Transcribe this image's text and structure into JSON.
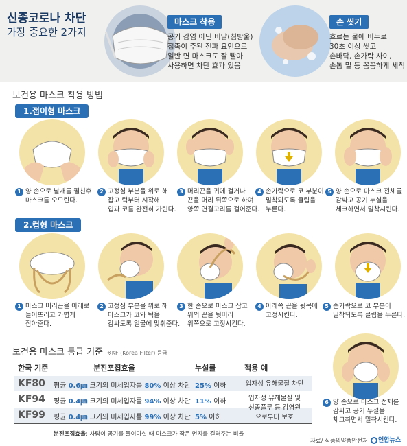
{
  "header": {
    "title_line1": "신종코로나 차단",
    "title_line2": "가장 중요한 2가지"
  },
  "mask_wearing": {
    "badge": "마스크 착용",
    "lines": [
      "공기 감염 아닌 비말(침방울)",
      "접촉이 주된 전파 요인으로",
      "일반 면 마스크도 잘 빨아",
      "사용하면 차단 효과 있음"
    ]
  },
  "hand_washing": {
    "badge": "손 씻기",
    "lines": [
      "흐르는 물에 비누로",
      "30초 이상 씻고",
      "손바닥, 손가락 사이,",
      "손톱 밑 등 꼼꼼하게 세척"
    ]
  },
  "method_title": "보건용 마스크 착용 방법",
  "foldable": {
    "label": "1.접이형 마스크",
    "steps": [
      {
        "num": "1",
        "lines": [
          "양 손으로 날개를 펼친후",
          "마스크를 오므린다."
        ]
      },
      {
        "num": "2",
        "lines": [
          "고정심 부분을 위로 해",
          "잡고 턱부터 시작해",
          "입과 코를 완전히 가린다."
        ]
      },
      {
        "num": "3",
        "lines": [
          "머리끈을 귀에 걸거나",
          "끈을 머리 뒤쪽으로 하여",
          "양쪽 연결고리를 걸어준다."
        ]
      },
      {
        "num": "4",
        "lines": [
          "손가락으로 코 부분이",
          "밀착되도록 클립을",
          "누른다."
        ]
      },
      {
        "num": "5",
        "lines": [
          "양 손으로 마스크 전체를",
          "감싸고 공기 누설을",
          "체크하면서 밀착시킨다."
        ]
      }
    ]
  },
  "cup": {
    "label": "2.컵형 마스크",
    "steps": [
      {
        "num": "1",
        "lines": [
          "마스크 머리끈을 아래로",
          "늘어뜨리고 가볍게",
          "잡아준다."
        ]
      },
      {
        "num": "2",
        "lines": [
          "고정심 부분을 위로 해",
          "마스크가 코와 턱을",
          "감싸도록 얼굴에 맞춰준다."
        ]
      },
      {
        "num": "3",
        "lines": [
          "한 손으로 마스크 잡고",
          "위의 끈을 뒷머리",
          "위쪽으로 고정시킨다."
        ]
      },
      {
        "num": "4",
        "lines": [
          "아래쪽 끈을 뒷목에",
          "고정시킨다."
        ]
      },
      {
        "num": "5",
        "lines": [
          "손가락으로 코 부분이",
          "밀착되도록 클립을 누른다."
        ]
      },
      {
        "num": "6",
        "lines": [
          "양 손으로 마스크 전체를",
          "감싸고 공기 누설을",
          "체크하면서 밀착시킨다."
        ]
      }
    ]
  },
  "grades": {
    "title": "보건용 마스크 등급 기준",
    "note": "※KF (Korea Filter) 등급",
    "headers": [
      "한국 기준",
      "분진포집효율",
      "누설률",
      "적용 예"
    ],
    "rows": [
      {
        "kf": "KF80",
        "pre": "평균 ",
        "size": "0.6㎛",
        "mid": " 크기의 미세입자를 ",
        "pct": "80%",
        "post": " 이상 차단",
        "leak_val": "25%",
        "leak_suffix": " 이하"
      },
      {
        "kf": "KF94",
        "pre": "평균 ",
        "size": "0.4㎛",
        "mid": " 크기의 미세입자를 ",
        "pct": "94%",
        "post": " 이상 차단",
        "leak_val": "11%",
        "leak_suffix": " 이하"
      },
      {
        "kf": "KF99",
        "pre": "평균 ",
        "size": "0.4㎛",
        "mid": " 크기의 미세입자를 ",
        "pct": "99%",
        "post": " 이상 차단",
        "leak_val": "5%",
        "leak_suffix": " 이하"
      }
    ],
    "usage_1": "입자성 유해물질 차단",
    "usage_2": [
      "입자성 유해물질 및",
      "신종플루 등 감염원",
      "으로부터 보호"
    ]
  },
  "footnote": {
    "label": "분진포집효율",
    "text": ": 사람이 공기를 들이마실 때 마스크가 작은 먼지를 걸러주는 비율"
  },
  "source": "자료/ 식품의약품안전처",
  "logo": "연합뉴스",
  "colors": {
    "accent": "#2b6fb5",
    "circle": "#f4e3a8",
    "banner": "#f0f0ee"
  }
}
